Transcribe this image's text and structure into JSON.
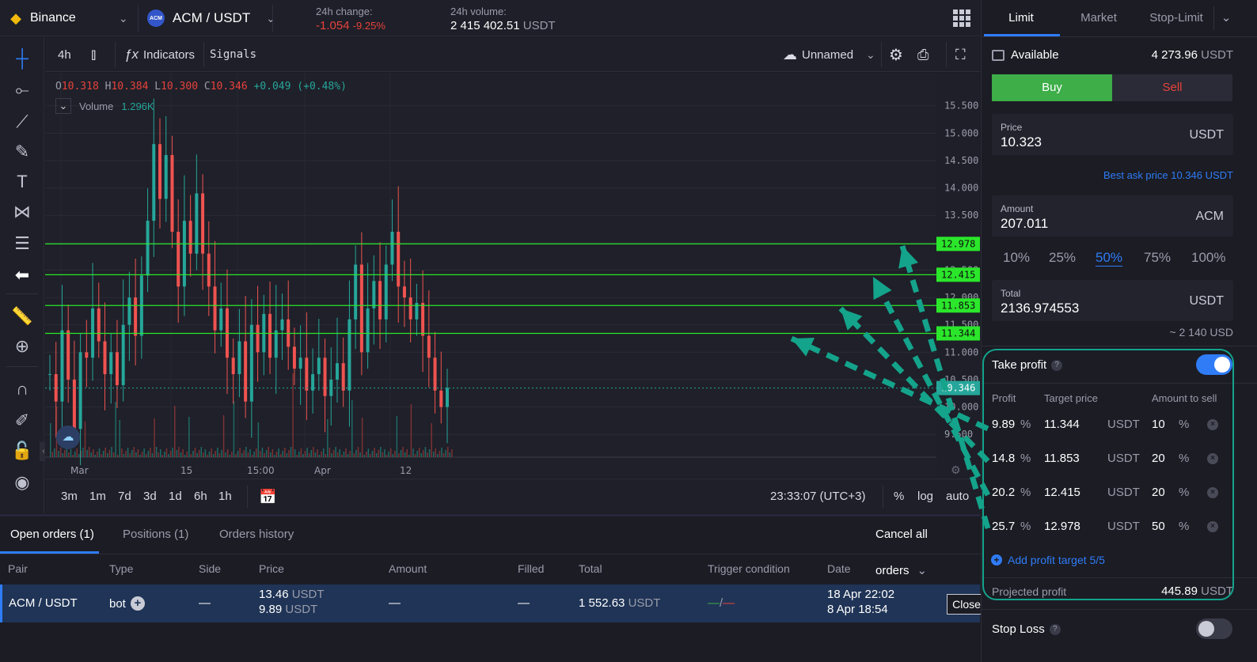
{
  "topbar": {
    "exchange": "Binance",
    "pair": "ACM / USDT",
    "pair_badge": "ACM",
    "change_label": "24h change:",
    "change_value": "-1.054",
    "change_pct": "-9.25%",
    "volume_label": "24h volume:",
    "volume_value": "2 415 402.51",
    "volume_unit": "USDT"
  },
  "chart_toolbar": {
    "interval": "4h",
    "indicators": "Indicators",
    "signals": "Signals",
    "layout_name": "Unnamed"
  },
  "ohlc": {
    "o_label": "O",
    "o": "10.318",
    "h_label": "H",
    "h": "10.384",
    "l_label": "L",
    "l": "10.300",
    "c_label": "C",
    "c": "10.346",
    "change": "+0.049 (+0.48%)"
  },
  "volume_legend": {
    "label": "Volume",
    "value": "1.296K"
  },
  "chart_data": {
    "type": "line",
    "price_ticks": [
      "15.500",
      "15.000",
      "14.500",
      "14.000",
      "13.500",
      "13.000",
      "12.500",
      "12.000",
      "11.500",
      "11.000",
      "10.500",
      "10.000",
      "9.500"
    ],
    "x_ticks": [
      "Mar",
      "15",
      "15:00",
      "Apr",
      "12"
    ],
    "ylim": [
      9.2,
      15.9
    ],
    "last_price": 10.346,
    "last_price_label": "10.346",
    "take_profit_levels": [
      11.344,
      11.853,
      12.415,
      12.978
    ],
    "take_profit_labels": [
      "11.344",
      "11.853",
      "12.415",
      "12.978"
    ],
    "series": [
      {
        "values": [
          10.6,
          10.1,
          11.4,
          10.5,
          9.6,
          11.0,
          10.9,
          11.8,
          11.2,
          10.6,
          11.0,
          10.4,
          11.5,
          12.0,
          11.3,
          12.4,
          13.4,
          14.8,
          13.8,
          14.6,
          13.2,
          12.2,
          13.4,
          12.8,
          13.9,
          12.8,
          12.2,
          11.4,
          11.8,
          10.9,
          10.6,
          11.2,
          10.1,
          11.5,
          11.0,
          11.7,
          10.9,
          11.4,
          11.6,
          11.1,
          10.7,
          10.9,
          10.3,
          10.6,
          10.9,
          10.2,
          10.5,
          10.8,
          10.3,
          11.6,
          12.6,
          11.0,
          11.8,
          12.3,
          11.6,
          12.6,
          13.2,
          12.2,
          12.0,
          11.6,
          11.9,
          11.3,
          10.9,
          10.3,
          10.0,
          10.35
        ]
      }
    ]
  },
  "timeframes": [
    "3m",
    "1m",
    "7d",
    "3d",
    "1d",
    "6h",
    "1h"
  ],
  "chart_bottom": {
    "clock": "23:33:07 (UTC+3)",
    "pct": "%",
    "log": "log",
    "auto": "auto"
  },
  "orders": {
    "tabs": [
      "Open orders (1)",
      "Positions (1)",
      "Orders history"
    ],
    "cancel_all": "Cancel all orders",
    "columns": [
      "Pair",
      "Type",
      "Side",
      "Price",
      "Amount",
      "Filled",
      "Total",
      "Trigger condition",
      "Date"
    ],
    "row": {
      "pair": "ACM / USDT",
      "type": "bot",
      "side": "—",
      "price1": "13.46",
      "price2": "9.89",
      "price_unit": "USDT",
      "amount": "—",
      "filled": "—",
      "total": "1 552.63",
      "total_unit": "USDT",
      "date1": "18 Apr 22:02",
      "date2": "8 Apr 18:54",
      "close": "Close"
    }
  },
  "order_form": {
    "tabs": [
      "Limit",
      "Market",
      "Stop-Limit"
    ],
    "available_label": "Available",
    "available_value": "4 273.96",
    "available_unit": "USDT",
    "buy": "Buy",
    "sell": "Sell",
    "price_label": "Price",
    "price_value": "10.323",
    "price_unit": "USDT",
    "best_ask": "Best ask price 10.346 USDT",
    "amount_label": "Amount",
    "amount_value": "207.011",
    "amount_unit": "ACM",
    "percents": [
      "10%",
      "25%",
      "50%",
      "75%",
      "100%"
    ],
    "selected_percent": "50%",
    "total_label": "Total",
    "total_value": "2136.974553",
    "total_unit": "USDT",
    "approx": "~ 2 140 USD",
    "take_profit": {
      "title": "Take profit",
      "enabled": true,
      "headers": [
        "Profit",
        "Target price",
        "Amount to sell"
      ],
      "targets": [
        {
          "profit": "9.89",
          "price": "11.344",
          "unit": "USDT",
          "amount": "10"
        },
        {
          "profit": "14.8",
          "price": "11.853",
          "unit": "USDT",
          "amount": "20"
        },
        {
          "profit": "20.2",
          "price": "12.415",
          "unit": "USDT",
          "amount": "20"
        },
        {
          "profit": "25.7",
          "price": "12.978",
          "unit": "USDT",
          "amount": "50"
        }
      ],
      "pct_sign": "%",
      "add_target": "Add profit target 5/5",
      "projected_label": "Projected profit",
      "projected_value": "445.89",
      "projected_unit": "USDT"
    },
    "stop_loss": {
      "title": "Stop Loss",
      "enabled": false
    }
  },
  "colors": {
    "accent": "#2f7cf6",
    "buy": "#3dae48",
    "sell": "#e8423c",
    "tp_line": "#2be62b",
    "annotation": "#14a38b"
  }
}
